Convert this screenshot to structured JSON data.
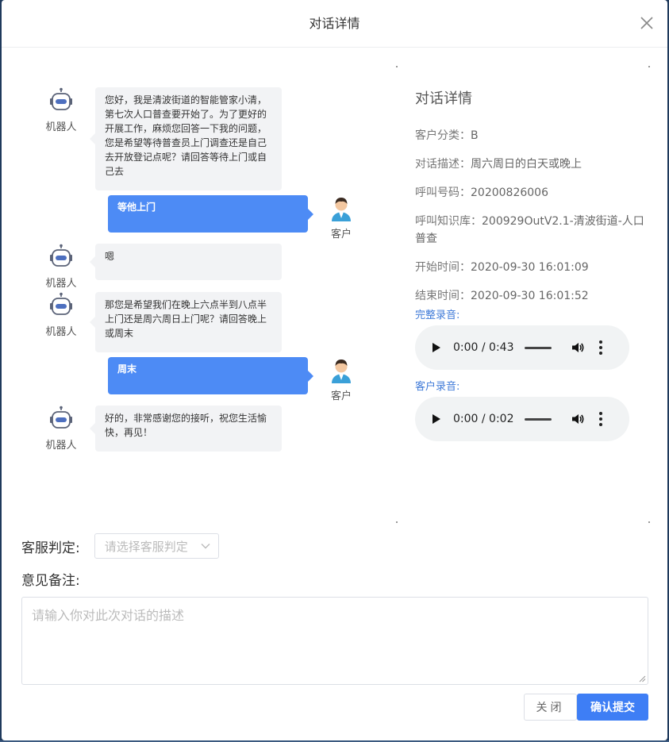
{
  "dialog": {
    "title": "对话详情",
    "close_icon": "close-icon"
  },
  "chat": {
    "bot_label": "机器人",
    "user_label": "客户",
    "messages": [
      {
        "role": "bot",
        "text": "您好，我是清波街道的智能管家小清，第七次人口普查要开始了。为了更好的开展工作，麻烦您回答一下我的问题，您是希望等待普查员上门调查还是自己去开放登记点呢？请回答等待上门或自己去"
      },
      {
        "role": "user",
        "text": "等他上门"
      },
      {
        "role": "bot",
        "text": "嗯"
      },
      {
        "role": "bot",
        "text": "那您是希望我们在晚上六点半到八点半上门还是周六周日上门呢？请回答晚上或周末"
      },
      {
        "role": "user",
        "text": "周末"
      },
      {
        "role": "bot",
        "text": "好的，非常感谢您的接听，祝您生活愉快，再见！"
      }
    ]
  },
  "details": {
    "title": "对话详情",
    "category": {
      "label": "客户分类：",
      "value": "B"
    },
    "description": {
      "label": "对话描述：",
      "value": "周六周日的白天或晚上"
    },
    "call_number": {
      "label": "呼叫号码：",
      "value": "20200826006"
    },
    "knowledge_base": {
      "label": "呼叫知识库：",
      "value": "200929OutV2.1-清波街道-人口普查"
    },
    "start_time": {
      "label": "开始时间：",
      "value": "2020-09-30 16:01:09"
    },
    "end_time": {
      "label": "结束时间：",
      "value": "2020-09-30 16:01:52"
    },
    "full_recording": {
      "label": "完整录音:",
      "time": "0:00 / 0:43"
    },
    "customer_recording": {
      "label": "客户录音:",
      "time": "0:00 / 0:02"
    }
  },
  "form": {
    "judge_label": "客服判定:",
    "judge_placeholder": "请选择客服判定",
    "note_label": "意见备注:",
    "note_placeholder": "请输入你对此次对话的描述"
  },
  "buttons": {
    "close": "关闭",
    "submit": "确认提交"
  },
  "colors": {
    "user_bubble": "#4d8bf5",
    "bot_bubble": "#f2f3f5",
    "primary": "#3e7ef5",
    "link": "#3f7ad8"
  }
}
